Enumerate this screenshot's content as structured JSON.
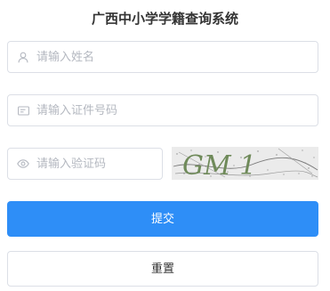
{
  "title": "广西中小学学籍查询系统",
  "form": {
    "name": {
      "placeholder": "请输入姓名",
      "icon": "user-icon",
      "value": ""
    },
    "idcard": {
      "placeholder": "请输入证件号码",
      "icon": "id-card-icon",
      "value": ""
    },
    "captcha": {
      "placeholder": "请输入验证码",
      "icon": "eye-icon",
      "value": ""
    }
  },
  "captcha_image": {
    "text": "GM 1"
  },
  "buttons": {
    "submit": "提交",
    "reset": "重置"
  },
  "colors": {
    "primary": "#2e8ef7",
    "border": "#dcdfe6",
    "placeholder": "#b4b8c0",
    "title": "#333333"
  }
}
